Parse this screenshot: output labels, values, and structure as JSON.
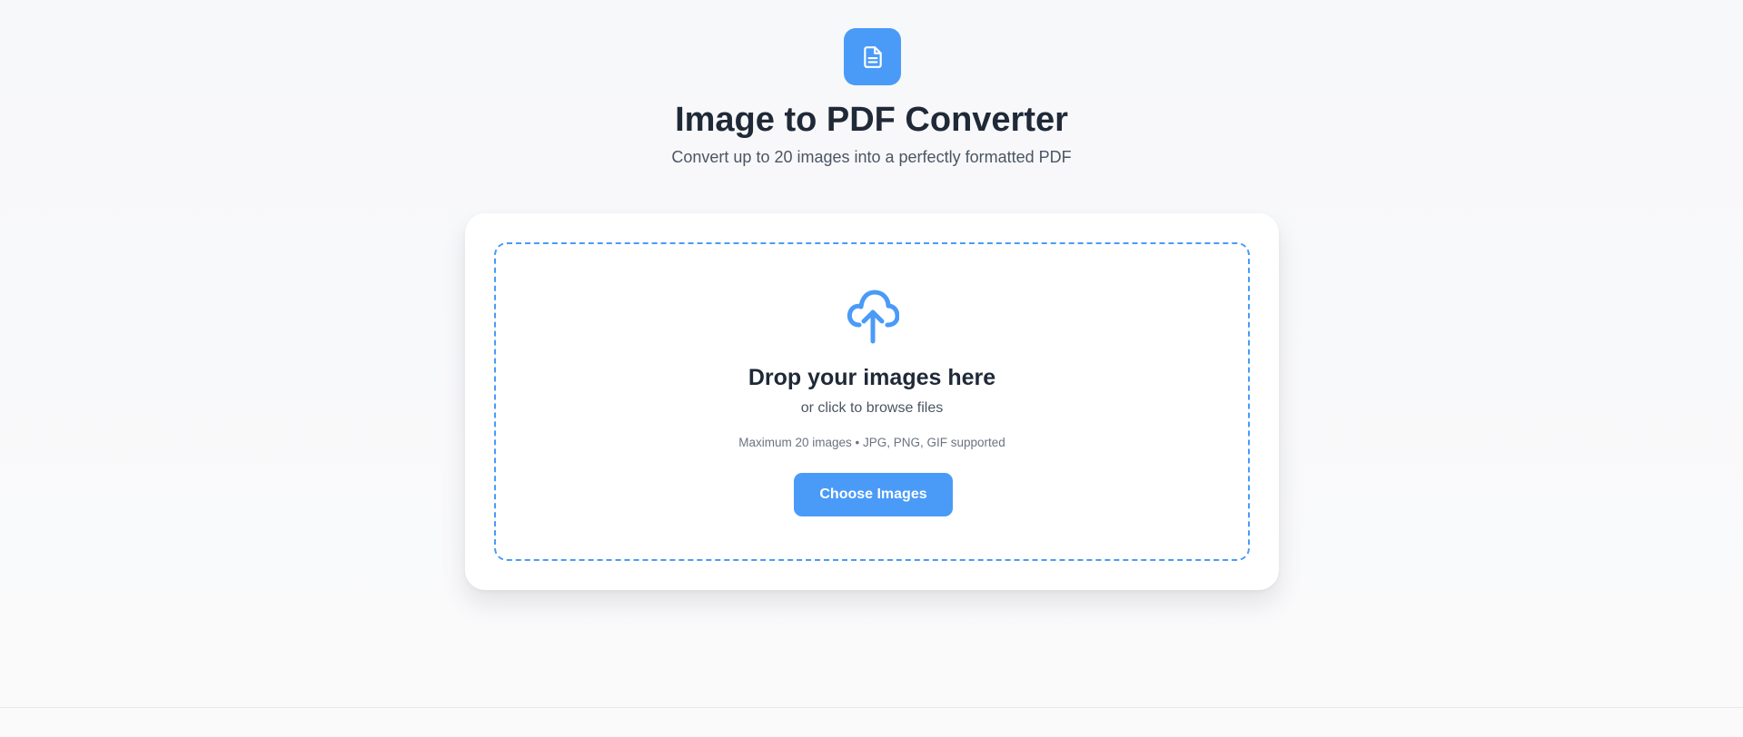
{
  "header": {
    "icon": "document-icon",
    "title": "Image to PDF Converter",
    "subtitle": "Convert up to 20 images into a perfectly formatted PDF"
  },
  "dropzone": {
    "icon": "cloud-upload-icon",
    "heading": "Drop your images here",
    "subheading": "or click to browse files",
    "note": "Maximum 20 images • JPG, PNG, GIF supported",
    "button_label": "Choose Images"
  },
  "colors": {
    "accent": "#4a9bf8",
    "heading_text": "#1f2937",
    "body_text": "#4b5563",
    "muted_text": "#6b7280",
    "background": "#f7f8fa",
    "card": "#ffffff"
  }
}
